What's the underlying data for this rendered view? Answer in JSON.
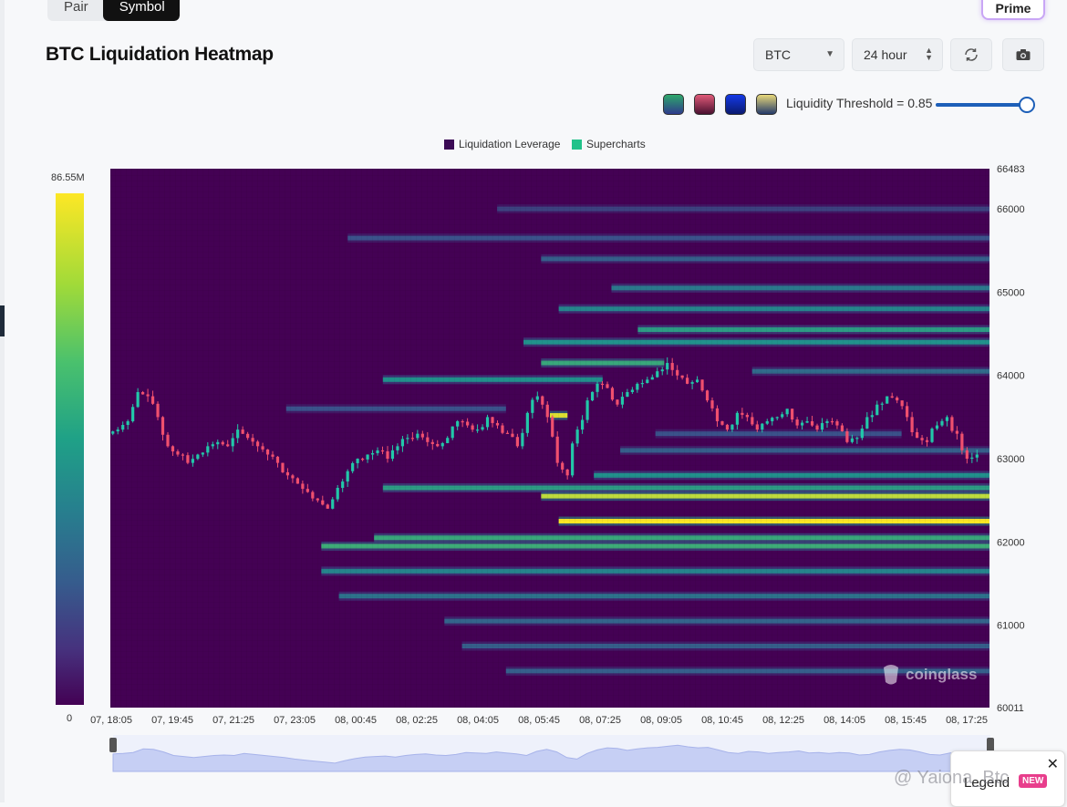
{
  "toolbar": {
    "tab_pair": "Pair",
    "tab_symbol": "Symbol",
    "prime_label": "Prime",
    "title": "BTC Liquidation Heatmap",
    "symbol_select": "BTC",
    "range_select": "24 hour",
    "refresh_icon": "refresh-icon",
    "camera_icon": "camera-icon"
  },
  "palette_swatches": [
    {
      "name": "viridis",
      "from": "#2ea86b",
      "to": "#2f3b8c"
    },
    {
      "name": "rose",
      "from": "#e05a78",
      "to": "#4a1030"
    },
    {
      "name": "blue",
      "from": "#1439e6",
      "to": "#0a1a70"
    },
    {
      "name": "gold",
      "from": "#e8d87a",
      "to": "#243a6a"
    }
  ],
  "threshold": {
    "label": "Liquidity Threshold = 0.85",
    "value": 0.85
  },
  "legend": {
    "items": [
      {
        "label": "Liquidation Leverage",
        "color": "#3b0a55"
      },
      {
        "label": "Supercharts",
        "color": "#22c28a"
      }
    ]
  },
  "colorbar": {
    "max_label": "86.55M",
    "min_label": "0"
  },
  "watermark": "coinglass",
  "legend_popup": {
    "label": "Legend",
    "badge": "NEW",
    "close": "✕"
  },
  "social_overlay": "@ Yaiona_Btc",
  "chart_data": {
    "type": "heatmap",
    "title": "BTC Liquidation Heatmap",
    "colors": {
      "background": "#440154",
      "low": "#31688e",
      "mid": "#21918c",
      "high": "#fde725"
    },
    "x_ticks": [
      "07, 18:05",
      "07, 19:45",
      "07, 21:25",
      "07, 23:05",
      "08, 00:45",
      "08, 02:25",
      "08, 04:05",
      "08, 05:45",
      "08, 07:25",
      "08, 09:05",
      "08, 10:45",
      "08, 12:25",
      "08, 14:05",
      "08, 15:45",
      "08, 17:25"
    ],
    "y_ticks": [
      60011,
      61000,
      62000,
      63000,
      64000,
      65000,
      66000,
      66483
    ],
    "ylim": [
      60011,
      66483
    ],
    "time_range_hours": 24,
    "price_series": [
      63300,
      63350,
      63450,
      63800,
      63750,
      63500,
      63150,
      63050,
      62950,
      63050,
      63150,
      63200,
      63150,
      63350,
      63250,
      63150,
      63050,
      62950,
      62800,
      62700,
      62600,
      62500,
      62400,
      62650,
      62850,
      63000,
      63050,
      63100,
      63000,
      63150,
      63250,
      63300,
      63200,
      63150,
      63250,
      63450,
      63400,
      63350,
      63500,
      63400,
      63300,
      63150,
      63550,
      63750,
      63500,
      62950,
      62800,
      63350,
      63700,
      63900,
      63850,
      63650,
      63800,
      63900,
      63950,
      64050,
      64150,
      64000,
      63900,
      63950,
      63700,
      63450,
      63350,
      63550,
      63500,
      63350,
      63450,
      63500,
      63600,
      63400,
      63450,
      63350,
      63450,
      63400,
      63200,
      63250,
      63500,
      63650,
      63750,
      63700,
      63500,
      63250,
      63200,
      63400,
      63500,
      63300,
      63000,
      63050
    ],
    "liquidation_bands": [
      {
        "price": 62250,
        "start": 0.51,
        "end": 1.0,
        "level": 1.0
      },
      {
        "price": 62550,
        "start": 0.49,
        "end": 1.0,
        "level": 0.9
      },
      {
        "price": 63520,
        "start": 0.5,
        "end": 0.52,
        "level": 0.95
      },
      {
        "price": 61950,
        "start": 0.24,
        "end": 1.0,
        "level": 0.62
      },
      {
        "price": 62050,
        "start": 0.3,
        "end": 1.0,
        "level": 0.6
      },
      {
        "price": 62650,
        "start": 0.31,
        "end": 1.0,
        "level": 0.55
      },
      {
        "price": 62800,
        "start": 0.55,
        "end": 1.0,
        "level": 0.5
      },
      {
        "price": 64150,
        "start": 0.49,
        "end": 0.63,
        "level": 0.6
      },
      {
        "price": 63950,
        "start": 0.31,
        "end": 0.56,
        "level": 0.5
      },
      {
        "price": 64400,
        "start": 0.47,
        "end": 1.0,
        "level": 0.5
      },
      {
        "price": 64550,
        "start": 0.6,
        "end": 1.0,
        "level": 0.55
      },
      {
        "price": 64800,
        "start": 0.51,
        "end": 1.0,
        "level": 0.45
      },
      {
        "price": 65050,
        "start": 0.57,
        "end": 1.0,
        "level": 0.4
      },
      {
        "price": 61650,
        "start": 0.24,
        "end": 1.0,
        "level": 0.45
      },
      {
        "price": 61350,
        "start": 0.26,
        "end": 1.0,
        "level": 0.38
      },
      {
        "price": 61050,
        "start": 0.38,
        "end": 1.0,
        "level": 0.32
      },
      {
        "price": 60750,
        "start": 0.4,
        "end": 1.0,
        "level": 0.3
      },
      {
        "price": 60450,
        "start": 0.45,
        "end": 1.0,
        "level": 0.3
      },
      {
        "price": 65400,
        "start": 0.49,
        "end": 1.0,
        "level": 0.3
      },
      {
        "price": 65650,
        "start": 0.27,
        "end": 1.0,
        "level": 0.25
      },
      {
        "price": 66000,
        "start": 0.44,
        "end": 1.0,
        "level": 0.2
      },
      {
        "price": 63600,
        "start": 0.2,
        "end": 0.45,
        "level": 0.25
      },
      {
        "price": 63100,
        "start": 0.58,
        "end": 1.0,
        "level": 0.3
      },
      {
        "price": 63300,
        "start": 0.62,
        "end": 0.9,
        "level": 0.25
      },
      {
        "price": 64050,
        "start": 0.73,
        "end": 1.0,
        "level": 0.35
      }
    ]
  }
}
